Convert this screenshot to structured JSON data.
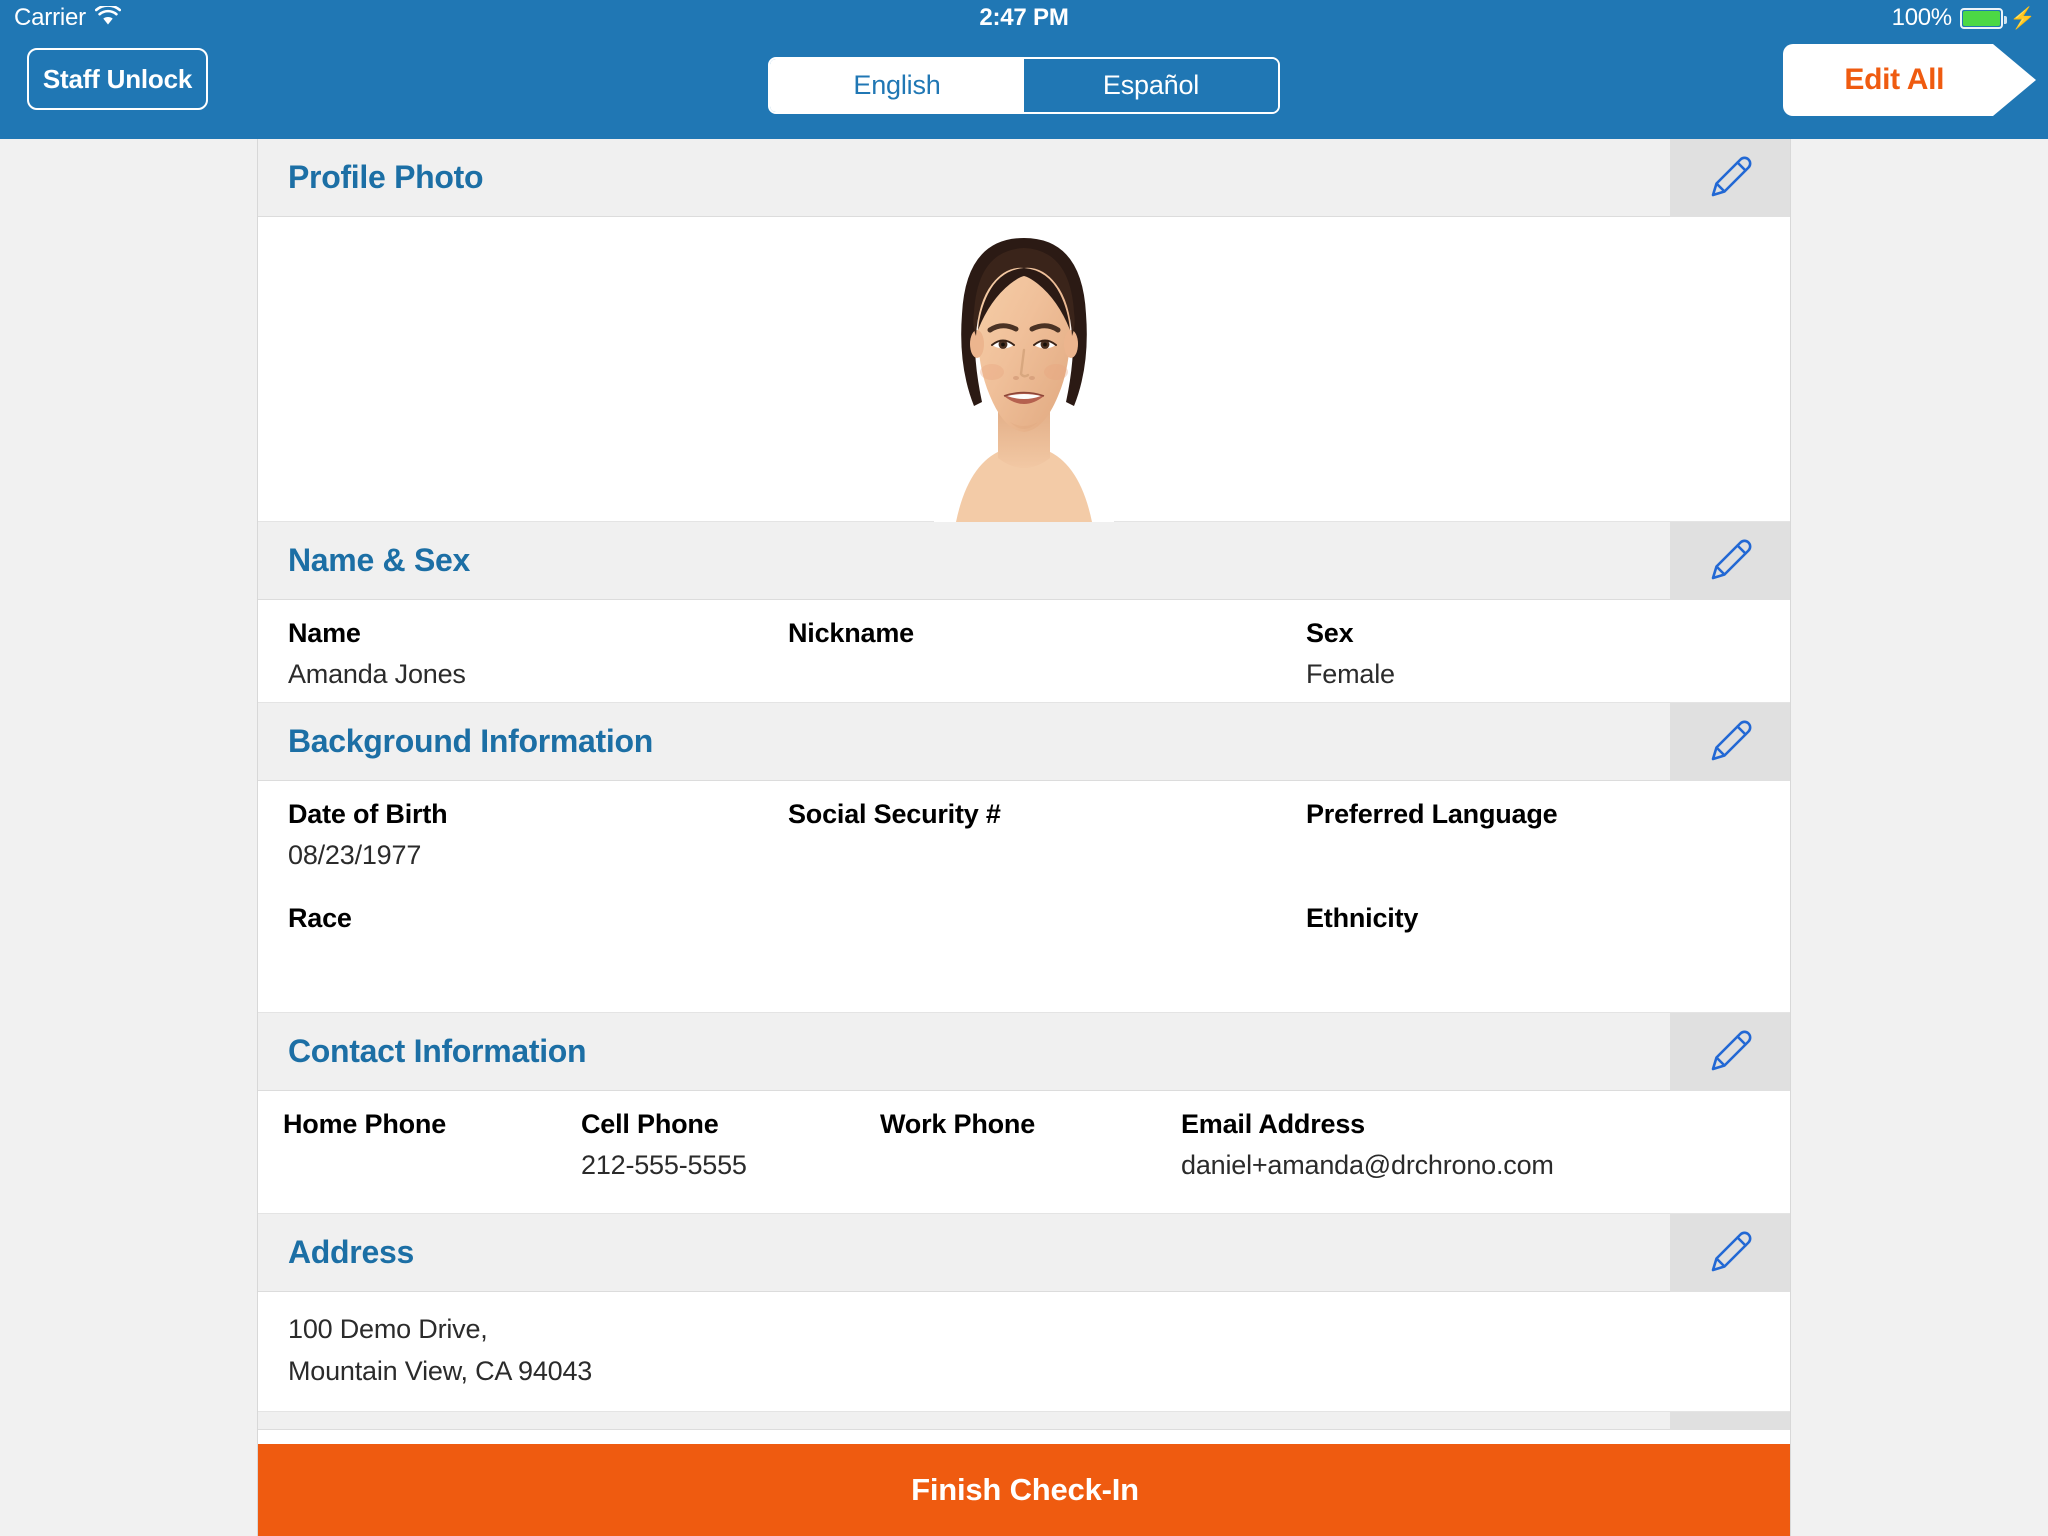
{
  "status_bar": {
    "carrier": "Carrier",
    "wifi_icon": "wifi-icon",
    "time": "2:47 PM",
    "battery_percent": "100%",
    "battery_icon": "battery-full-icon",
    "charging_icon": "lightning-bolt-icon"
  },
  "nav": {
    "staff_unlock_label": "Staff Unlock",
    "edit_all_label": "Edit All",
    "language": {
      "options": [
        "English",
        "Español"
      ],
      "selected": "English"
    }
  },
  "colors": {
    "nav_blue": "#2077b4",
    "accent_orange": "#ef5b10",
    "section_title_blue": "#1c6fa5",
    "section_header_gray": "#f0f0f0",
    "pencil_cell_gray": "#e0e0e0",
    "battery_green": "#4cd845"
  },
  "sections": {
    "profile_photo": {
      "title": "Profile Photo",
      "edit_icon": "pencil-icon",
      "photo_alt": "patient-profile-photo"
    },
    "name_sex": {
      "title": "Name & Sex",
      "edit_icon": "pencil-icon",
      "fields": [
        {
          "label": "Name",
          "value": "Amanda Jones"
        },
        {
          "label": "Nickname",
          "value": ""
        },
        {
          "label": "Sex",
          "value": "Female"
        }
      ]
    },
    "background_information": {
      "title": "Background Information",
      "edit_icon": "pencil-icon",
      "fields_row1": [
        {
          "label": "Date of Birth",
          "value": "08/23/1977"
        },
        {
          "label": "Social Security #",
          "value": ""
        },
        {
          "label": "Preferred Language",
          "value": ""
        }
      ],
      "fields_row2": [
        {
          "label": "Race",
          "value": ""
        },
        {
          "label": "Ethnicity",
          "value": ""
        }
      ]
    },
    "contact_information": {
      "title": "Contact Information",
      "edit_icon": "pencil-icon",
      "fields": [
        {
          "label": "Home Phone",
          "value": ""
        },
        {
          "label": "Cell Phone",
          "value": "212-555-5555"
        },
        {
          "label": "Work Phone",
          "value": ""
        },
        {
          "label": "Email Address",
          "value": "daniel+amanda@drchrono.com"
        }
      ]
    },
    "address": {
      "title": "Address",
      "edit_icon": "pencil-icon",
      "line1": "100 Demo Drive,",
      "line2": "Mountain View, CA 94043"
    }
  },
  "footer": {
    "finish_label": "Finish Check-In"
  }
}
